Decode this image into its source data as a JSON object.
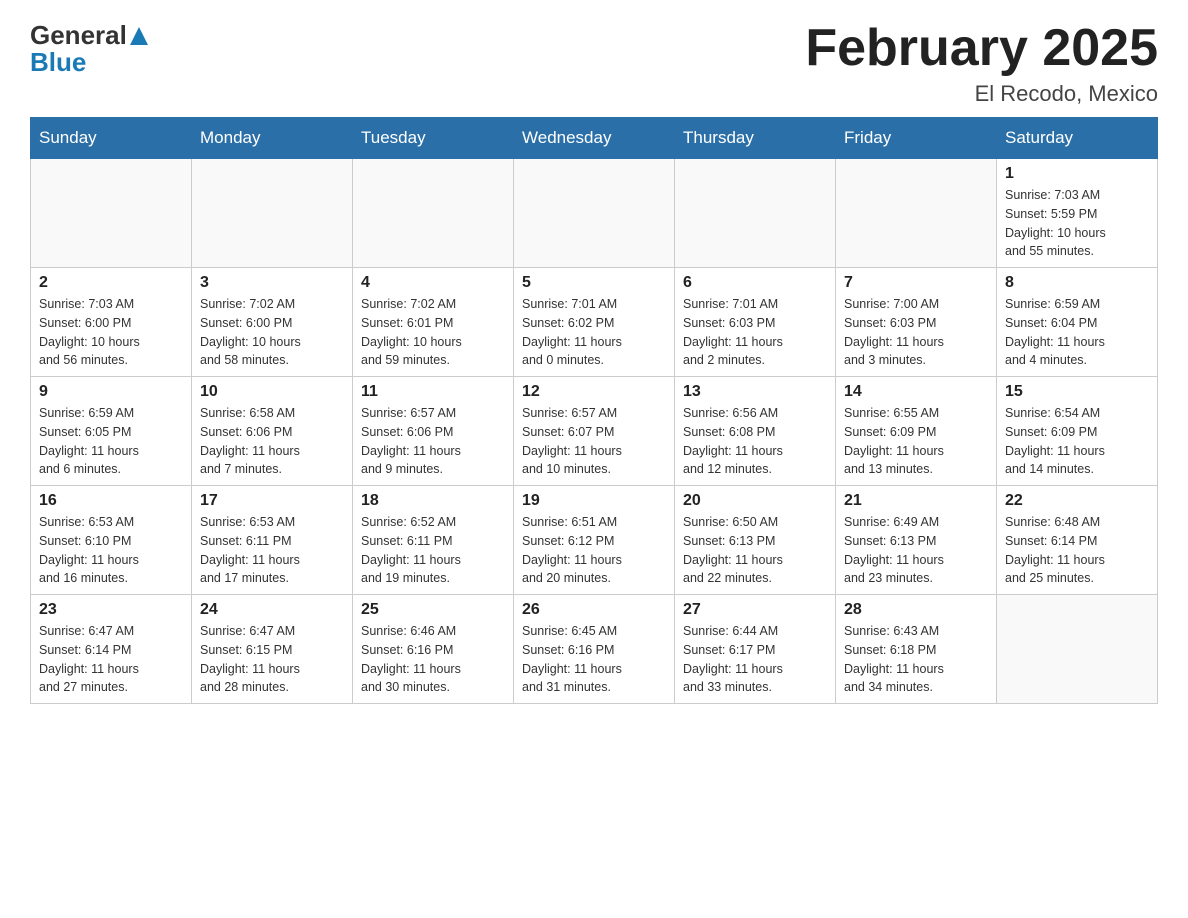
{
  "logo": {
    "general": "General",
    "blue": "Blue"
  },
  "title": "February 2025",
  "location": "El Recodo, Mexico",
  "days_of_week": [
    "Sunday",
    "Monday",
    "Tuesday",
    "Wednesday",
    "Thursday",
    "Friday",
    "Saturday"
  ],
  "weeks": [
    [
      {
        "day": "",
        "info": ""
      },
      {
        "day": "",
        "info": ""
      },
      {
        "day": "",
        "info": ""
      },
      {
        "day": "",
        "info": ""
      },
      {
        "day": "",
        "info": ""
      },
      {
        "day": "",
        "info": ""
      },
      {
        "day": "1",
        "info": "Sunrise: 7:03 AM\nSunset: 5:59 PM\nDaylight: 10 hours\nand 55 minutes."
      }
    ],
    [
      {
        "day": "2",
        "info": "Sunrise: 7:03 AM\nSunset: 6:00 PM\nDaylight: 10 hours\nand 56 minutes."
      },
      {
        "day": "3",
        "info": "Sunrise: 7:02 AM\nSunset: 6:00 PM\nDaylight: 10 hours\nand 58 minutes."
      },
      {
        "day": "4",
        "info": "Sunrise: 7:02 AM\nSunset: 6:01 PM\nDaylight: 10 hours\nand 59 minutes."
      },
      {
        "day": "5",
        "info": "Sunrise: 7:01 AM\nSunset: 6:02 PM\nDaylight: 11 hours\nand 0 minutes."
      },
      {
        "day": "6",
        "info": "Sunrise: 7:01 AM\nSunset: 6:03 PM\nDaylight: 11 hours\nand 2 minutes."
      },
      {
        "day": "7",
        "info": "Sunrise: 7:00 AM\nSunset: 6:03 PM\nDaylight: 11 hours\nand 3 minutes."
      },
      {
        "day": "8",
        "info": "Sunrise: 6:59 AM\nSunset: 6:04 PM\nDaylight: 11 hours\nand 4 minutes."
      }
    ],
    [
      {
        "day": "9",
        "info": "Sunrise: 6:59 AM\nSunset: 6:05 PM\nDaylight: 11 hours\nand 6 minutes."
      },
      {
        "day": "10",
        "info": "Sunrise: 6:58 AM\nSunset: 6:06 PM\nDaylight: 11 hours\nand 7 minutes."
      },
      {
        "day": "11",
        "info": "Sunrise: 6:57 AM\nSunset: 6:06 PM\nDaylight: 11 hours\nand 9 minutes."
      },
      {
        "day": "12",
        "info": "Sunrise: 6:57 AM\nSunset: 6:07 PM\nDaylight: 11 hours\nand 10 minutes."
      },
      {
        "day": "13",
        "info": "Sunrise: 6:56 AM\nSunset: 6:08 PM\nDaylight: 11 hours\nand 12 minutes."
      },
      {
        "day": "14",
        "info": "Sunrise: 6:55 AM\nSunset: 6:09 PM\nDaylight: 11 hours\nand 13 minutes."
      },
      {
        "day": "15",
        "info": "Sunrise: 6:54 AM\nSunset: 6:09 PM\nDaylight: 11 hours\nand 14 minutes."
      }
    ],
    [
      {
        "day": "16",
        "info": "Sunrise: 6:53 AM\nSunset: 6:10 PM\nDaylight: 11 hours\nand 16 minutes."
      },
      {
        "day": "17",
        "info": "Sunrise: 6:53 AM\nSunset: 6:11 PM\nDaylight: 11 hours\nand 17 minutes."
      },
      {
        "day": "18",
        "info": "Sunrise: 6:52 AM\nSunset: 6:11 PM\nDaylight: 11 hours\nand 19 minutes."
      },
      {
        "day": "19",
        "info": "Sunrise: 6:51 AM\nSunset: 6:12 PM\nDaylight: 11 hours\nand 20 minutes."
      },
      {
        "day": "20",
        "info": "Sunrise: 6:50 AM\nSunset: 6:13 PM\nDaylight: 11 hours\nand 22 minutes."
      },
      {
        "day": "21",
        "info": "Sunrise: 6:49 AM\nSunset: 6:13 PM\nDaylight: 11 hours\nand 23 minutes."
      },
      {
        "day": "22",
        "info": "Sunrise: 6:48 AM\nSunset: 6:14 PM\nDaylight: 11 hours\nand 25 minutes."
      }
    ],
    [
      {
        "day": "23",
        "info": "Sunrise: 6:47 AM\nSunset: 6:14 PM\nDaylight: 11 hours\nand 27 minutes."
      },
      {
        "day": "24",
        "info": "Sunrise: 6:47 AM\nSunset: 6:15 PM\nDaylight: 11 hours\nand 28 minutes."
      },
      {
        "day": "25",
        "info": "Sunrise: 6:46 AM\nSunset: 6:16 PM\nDaylight: 11 hours\nand 30 minutes."
      },
      {
        "day": "26",
        "info": "Sunrise: 6:45 AM\nSunset: 6:16 PM\nDaylight: 11 hours\nand 31 minutes."
      },
      {
        "day": "27",
        "info": "Sunrise: 6:44 AM\nSunset: 6:17 PM\nDaylight: 11 hours\nand 33 minutes."
      },
      {
        "day": "28",
        "info": "Sunrise: 6:43 AM\nSunset: 6:18 PM\nDaylight: 11 hours\nand 34 minutes."
      },
      {
        "day": "",
        "info": ""
      }
    ]
  ],
  "colors": {
    "header_bg": "#2a6fa8",
    "header_text": "#ffffff",
    "border": "#cccccc",
    "text_primary": "#333333"
  }
}
